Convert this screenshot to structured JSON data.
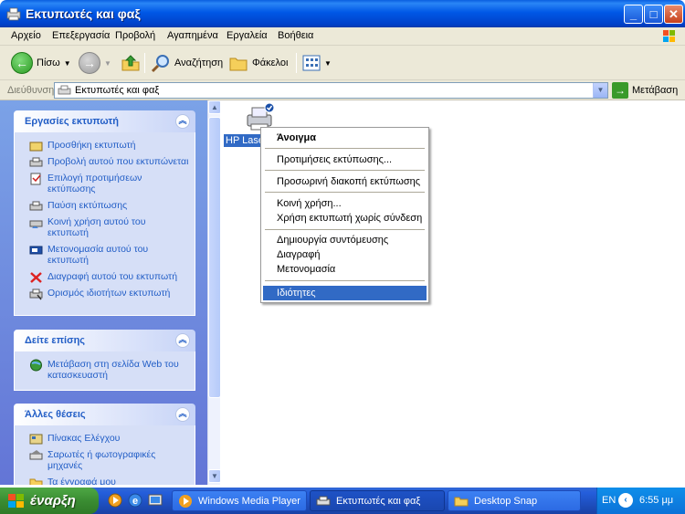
{
  "window": {
    "title": "Εκτυπωτές και φαξ",
    "controls": [
      "minimize",
      "maximize",
      "close"
    ]
  },
  "menubar": {
    "items": [
      "Αρχείο",
      "Επεξεργασία",
      "Προβολή",
      "Αγαπημένα",
      "Εργαλεία",
      "Βοήθεια"
    ]
  },
  "toolbar": {
    "back_label": "Πίσω",
    "search_label": "Αναζήτηση",
    "folders_label": "Φάκελοι"
  },
  "address": {
    "label": "Διεύθυνση",
    "value": "Εκτυπωτές και φαξ",
    "go_label": "Μετάβαση"
  },
  "taskpane": {
    "printer_tasks": {
      "title": "Εργασίες εκτυπωτή",
      "items": [
        {
          "label": "Προσθήκη εκτυπωτή"
        },
        {
          "label": "Προβολή αυτού που εκτυπώνεται"
        },
        {
          "label": "Επιλογή προτιμήσεων εκτύπωσης"
        },
        {
          "label": "Παύση εκτύπωσης"
        },
        {
          "label": "Κοινή χρήση αυτού του εκτυπωτή"
        },
        {
          "label": "Μετονομασία αυτού του εκτυπωτή"
        },
        {
          "label": "Διαγραφή αυτού του εκτυπωτή"
        },
        {
          "label": "Ορισμός ιδιοτήτων εκτυπωτή"
        }
      ]
    },
    "see_also": {
      "title": "Δείτε επίσης",
      "items": [
        {
          "label": "Μετάβαση στη σελίδα Web του κατασκευαστή"
        }
      ]
    },
    "other_places": {
      "title": "Άλλες θέσεις",
      "items": [
        {
          "label": "Πίνακας Ελέγχου"
        },
        {
          "label": "Σαρωτές ή φωτογραφικές μηχανές"
        },
        {
          "label": "Τα έγγραφά μου"
        }
      ]
    }
  },
  "content": {
    "printer_name": "HP LaserJet"
  },
  "context_menu": {
    "items": [
      {
        "label": "Άνοιγμα",
        "bold": true
      },
      {
        "label": "Προτιμήσεις εκτύπωσης..."
      },
      {
        "label": "Προσωρινή διακοπή εκτύπωσης"
      },
      {
        "label": "Κοινή χρήση..."
      },
      {
        "label": "Χρήση εκτυπωτή χωρίς σύνδεση"
      },
      {
        "label": "Δημιουργία συντόμευσης"
      },
      {
        "label": "Διαγραφή"
      },
      {
        "label": "Μετονομασία"
      },
      {
        "label": "Ιδιότητες",
        "highlighted": true
      }
    ]
  },
  "taskbar": {
    "start_label": "έναρξη",
    "buttons": [
      {
        "label": "Windows Media Player"
      },
      {
        "label": "Εκτυπωτές και φαξ"
      },
      {
        "label": "Desktop Snap"
      }
    ],
    "tray": {
      "language": "EN",
      "time": "6:55 μμ"
    }
  },
  "colors": {
    "title_bar": "#0058e6",
    "taskpane_bg": "#7ba2e7",
    "link_blue": "#215dc6",
    "selection": "#316ac5",
    "start_green": "#3a8c32"
  }
}
